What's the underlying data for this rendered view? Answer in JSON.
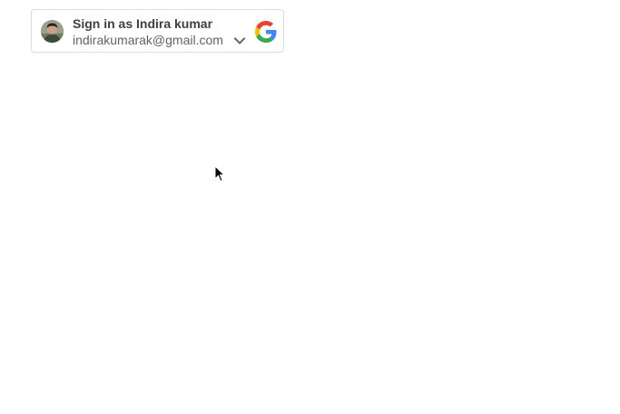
{
  "signin": {
    "title": "Sign in as Indira kumar",
    "email": "indirakumarak@gmail.com"
  },
  "icons": {
    "avatar": "user-avatar",
    "dropdown": "chevron-down-icon",
    "brand": "google-logo",
    "pointer": "mouse-cursor"
  },
  "colors": {
    "border": "#dadce0",
    "title": "#3c4043",
    "email": "#5f6368",
    "google_blue": "#4285F4",
    "google_red": "#EA4335",
    "google_yellow": "#FBBC05",
    "google_green": "#34A853"
  }
}
